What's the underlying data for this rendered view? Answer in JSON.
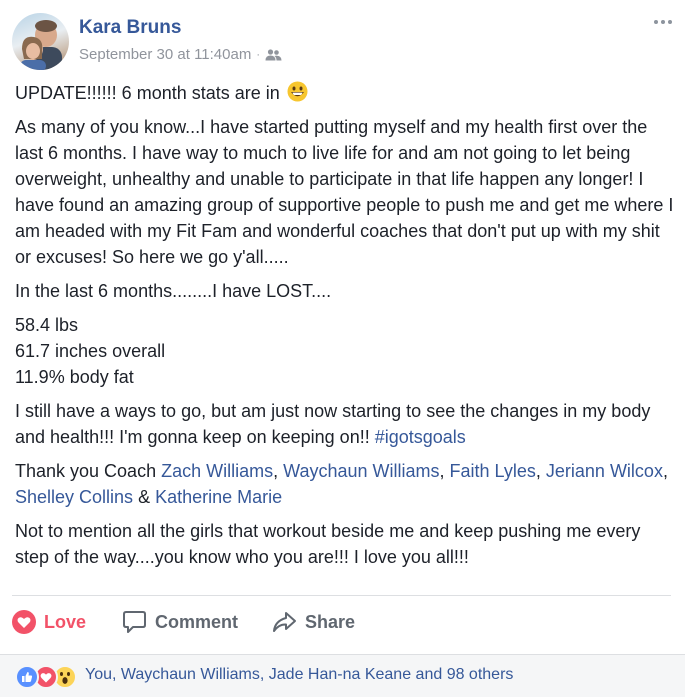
{
  "post": {
    "author": "Kara Bruns",
    "timestamp": "September 30 at 11:40am",
    "separator": "·",
    "audience_icon": "friends-icon",
    "menu_icon": "more-options-icon"
  },
  "content": {
    "line1": "UPDATE!!!!!! 6 month stats are in",
    "emoji1": "grinning-face-emoji",
    "paragraph2": "As many of you know...I have started putting myself and my health first over the last 6 months. I have way to much to live life for and am not going to let being overweight, unhealthy and unable to participate in that life happen any longer! I have found an amazing group of supportive people to push me and get me where I am headed with my Fit Fam and wonderful coaches that don't put up with my shit or excuses! So here we go y'all.....",
    "paragraph3": "In the last 6 months........I have LOST....",
    "stats": [
      "58.4 lbs",
      "61.7 inches overall",
      "11.9% body fat"
    ],
    "paragraph5_text": "I still have a ways to go, but am just now starting to see the changes in my body and health!!! I'm gonna keep on keeping on!! ",
    "hashtag": "#igotsgoals",
    "thanks_prefix": "Thank you Coach ",
    "tagged": [
      "Zach Williams",
      "Waychaun Williams",
      "Faith Lyles",
      "Jeriann Wilcox",
      "Shelley Collins",
      "Katherine Marie"
    ],
    "sep_comma": ", ",
    "sep_amp": " & ",
    "paragraph7": "Not to mention all the girls that workout beside me and keep pushing me every step of the way....you know who you are!!! I love you all!!!"
  },
  "actions": {
    "love_label": "Love",
    "comment_label": "Comment",
    "share_label": "Share"
  },
  "reactions": {
    "summary": "You, Waychaun Williams, Jade Han-na Keane and 98 others",
    "types": [
      "like",
      "love",
      "wow"
    ]
  },
  "colors": {
    "link": "#365899",
    "love": "#f25268",
    "muted": "#90949c"
  }
}
